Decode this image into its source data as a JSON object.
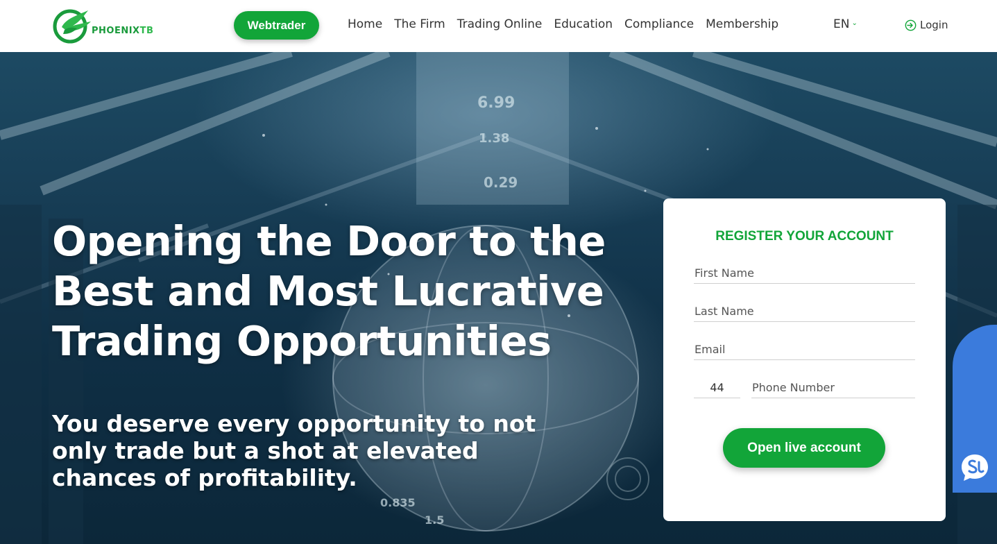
{
  "header": {
    "logo_text_a": "PHOENIX",
    "logo_text_b": "TB",
    "webtrader_label": "Webtrader",
    "nav": [
      "Home",
      "The Firm",
      "Trading Online",
      "Education",
      "Compliance",
      "Membership"
    ],
    "language": "EN",
    "login_label": "Login"
  },
  "hero": {
    "title_line1": "Opening the Door to the",
    "title_line2": "Best and Most Lucrative",
    "title_line3": "Trading Opportunities",
    "subtitle_line1": "You deserve every opportunity to not",
    "subtitle_line2": "only trade but a shot at elevated",
    "subtitle_line3": "chances of profitability.",
    "bg_numbers": [
      "6.99",
      "1.38",
      "0.29",
      "0.835",
      "1.5"
    ]
  },
  "register": {
    "title": "REGISTER YOUR ACCOUNT",
    "first_name_placeholder": "First Name",
    "last_name_placeholder": "Last Name",
    "email_placeholder": "Email",
    "phone_code": "44",
    "phone_placeholder": "Phone Number",
    "submit_label": "Open live account"
  },
  "colors": {
    "brand_green": "#12a539",
    "chat_blue": "#3b7bdc"
  },
  "icons": {
    "logo": "phoenix-bird-icon",
    "login": "login-arrow-icon",
    "language": "chevron-down-icon",
    "chat": "chat-bubble-icon"
  }
}
